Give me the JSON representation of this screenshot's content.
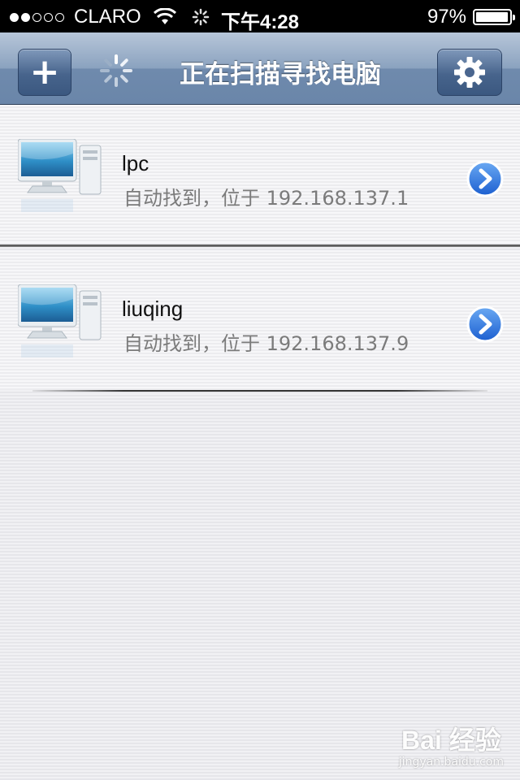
{
  "status_bar": {
    "carrier": "CLARO",
    "time": "下午4:28",
    "battery": "97%",
    "battery_level": 0.97,
    "signal_bars_filled": 2,
    "signal_bars_total": 5
  },
  "nav": {
    "title": "正在扫描寻找电脑",
    "add_label": "+",
    "icons": {
      "add": "plus-icon",
      "settings": "gear-icon",
      "loading": "spinner-icon"
    }
  },
  "computers": [
    {
      "name": "lpc",
      "subtitle": "自动找到，位于 192.168.137.1"
    },
    {
      "name": "liuqing",
      "subtitle": "自动找到，位于 192.168.137.9"
    }
  ],
  "watermark": {
    "logo": "Bai 经验",
    "url": "jingyan.baidu.com"
  },
  "colors": {
    "accent": "#2f6fdc",
    "nav_bar": "#6a86a9"
  }
}
